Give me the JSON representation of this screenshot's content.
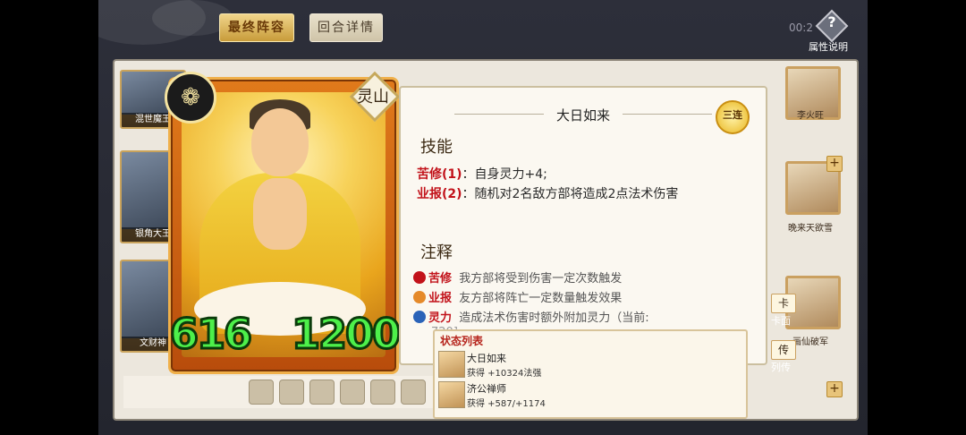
{
  "tabs": {
    "final_lineup": "最终阵容",
    "round_details": "回合详情"
  },
  "timer": "00:2",
  "help": {
    "icon": "?",
    "label": "属性说明"
  },
  "left_roster": [
    {
      "name": "混世魔王"
    },
    {
      "name": "银角大王"
    },
    {
      "name": "文财神"
    }
  ],
  "right_roster": [
    {
      "name": "李火旺"
    },
    {
      "name": "晚来天欲雪"
    },
    {
      "name": "画仙破军"
    }
  ],
  "card": {
    "emblem": "❁",
    "region": "灵山",
    "attack": "616",
    "hp": "1200"
  },
  "detail": {
    "title": "大日如来",
    "combo": "三连",
    "skills_heading": "技能",
    "skills": [
      {
        "tag": "苦修(1)",
        "text": "：自身灵力+4;"
      },
      {
        "tag": "业报(2)",
        "text": "：随机对2名敌方部将造成2点法术伤害"
      }
    ],
    "notes_heading": "注释",
    "notes": [
      {
        "tag": "苦修",
        "text": "我方部将受到伤害一定次数触发",
        "color": "#c2121a"
      },
      {
        "tag": "业报",
        "text": "友方部将阵亡一定数量触发效果",
        "color": "#d86b1a"
      },
      {
        "tag": "灵力",
        "text": "造成法术伤害时额外附加灵力（当前:",
        "color": "#2a63b8"
      }
    ],
    "note_overflow": "720]",
    "side_buttons": [
      {
        "icon": "卡",
        "label": "卡面"
      },
      {
        "icon": "传",
        "label": "列传"
      }
    ]
  },
  "status_list": {
    "title": "状态列表",
    "rows": [
      {
        "name": "大日如来",
        "gain": "获得 +10324法强"
      },
      {
        "name": "济公禅师",
        "gain": "获得 +587/+1174"
      }
    ]
  }
}
